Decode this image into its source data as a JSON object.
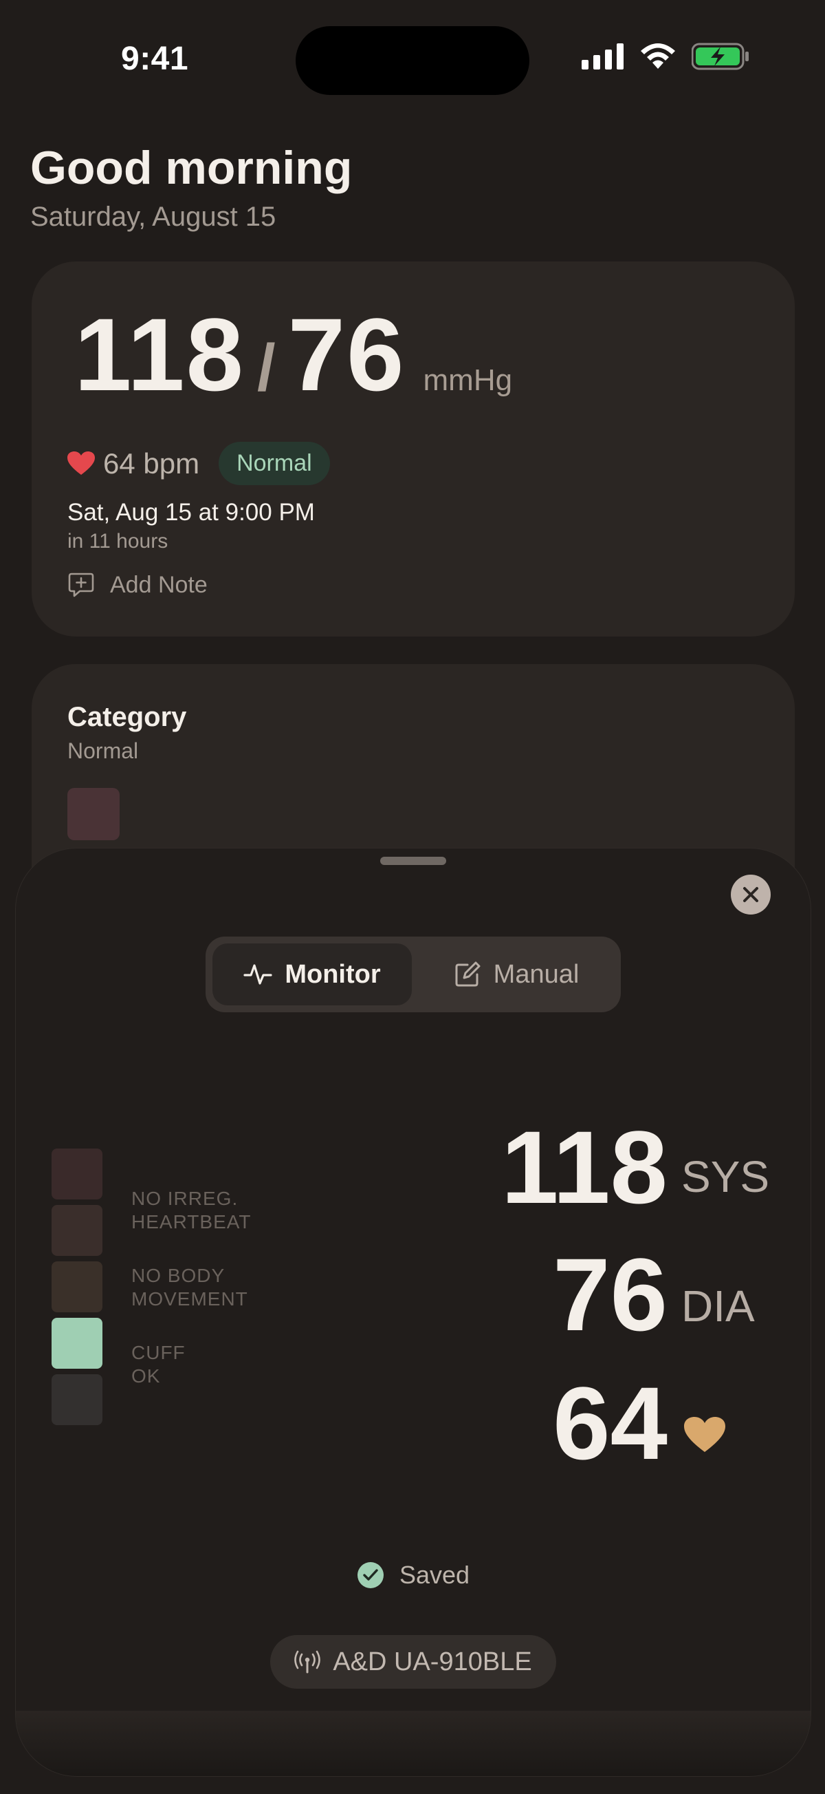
{
  "status_bar": {
    "time": "9:41"
  },
  "header": {
    "greeting": "Good morning",
    "date": "Saturday, August 15"
  },
  "reading_card": {
    "systolic": "118",
    "slash": "/",
    "diastolic": "76",
    "unit": "mmHg",
    "pulse": "64 bpm",
    "status_badge": "Normal",
    "next_time": "Sat, Aug 15 at 9:00 PM",
    "next_relative": "in 11 hours",
    "add_note_label": "Add Note"
  },
  "category_card": {
    "title": "Category",
    "value": "Normal"
  },
  "sheet": {
    "tabs": [
      {
        "label": "Monitor",
        "selected": true
      },
      {
        "label": "Manual",
        "selected": false
      }
    ],
    "indicators": [
      {
        "line1": "NO IRREG.",
        "line2": "HEARTBEAT"
      },
      {
        "line1": "NO BODY",
        "line2": "MOVEMENT"
      },
      {
        "line1": "CUFF",
        "line2": "OK"
      }
    ],
    "readings": {
      "sys_value": "118",
      "sys_label": "SYS",
      "dia_value": "76",
      "dia_label": "DIA",
      "pulse_value": "64"
    },
    "saved_label": "Saved",
    "device_name": "A&D UA-910BLE"
  },
  "colors": {
    "background": "#201c1a",
    "card": "#2b2623",
    "accent_green": "#a9d6b9",
    "heart_red": "#e5484d",
    "heart_gold": "#d9a86c",
    "cuff_ok": "#9fcfb3"
  }
}
